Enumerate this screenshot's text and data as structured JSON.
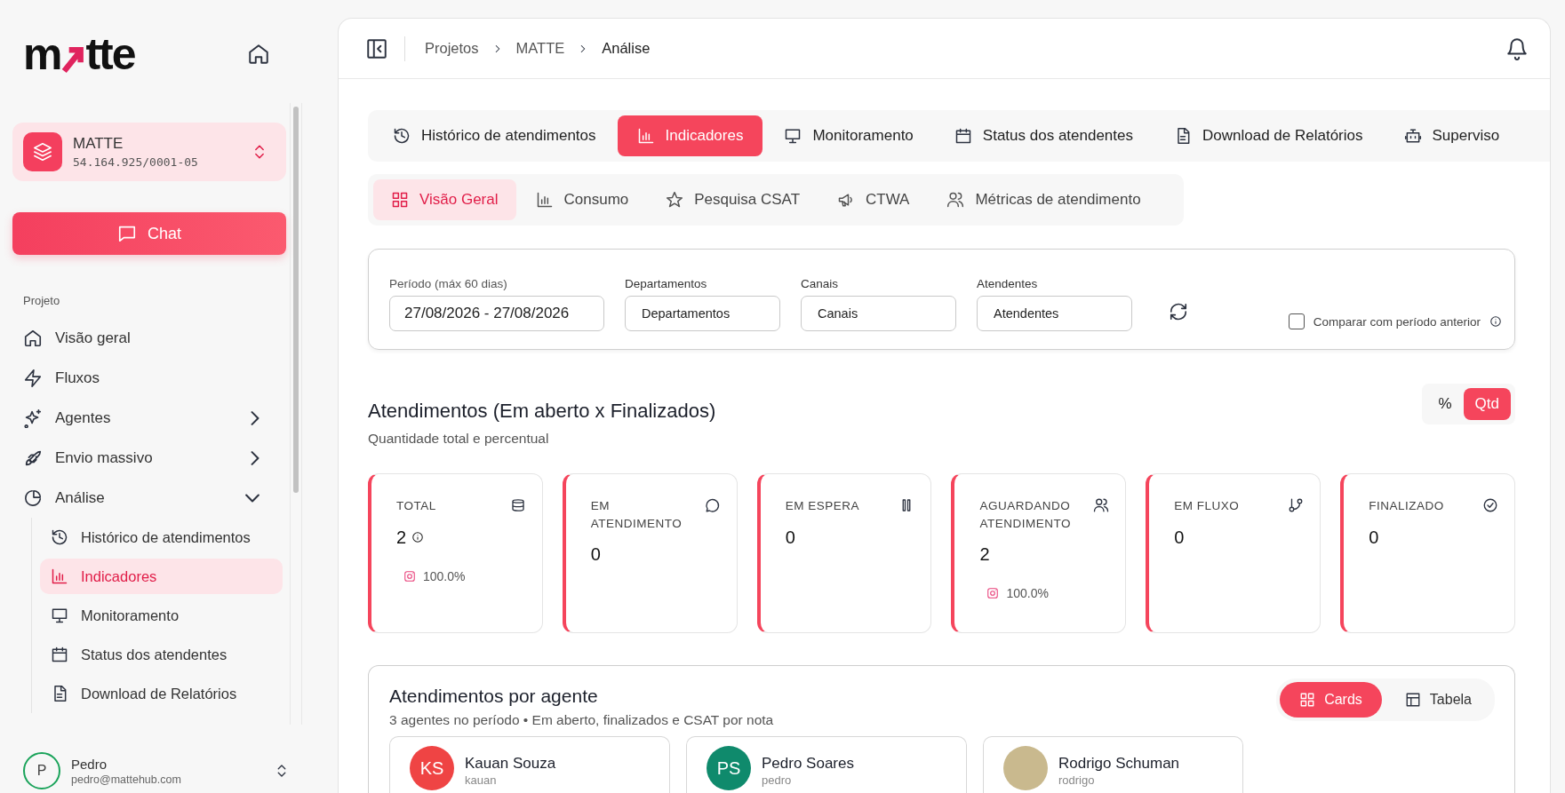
{
  "sidebar": {
    "logo": {
      "left": "m",
      "right": "tte"
    },
    "workspace": {
      "name": "MATTE",
      "id": "54.164.925/0001-05"
    },
    "chat_button": "Chat",
    "section_label": "Projeto",
    "nav": [
      {
        "label": "Visão geral"
      },
      {
        "label": "Fluxos"
      },
      {
        "label": "Agentes",
        "expanded": false
      },
      {
        "label": "Envio massivo",
        "expanded": false
      },
      {
        "label": "Análise",
        "expanded": true,
        "children": [
          {
            "label": "Histórico de atendimentos",
            "selected": false
          },
          {
            "label": "Indicadores",
            "selected": true
          },
          {
            "label": "Monitoramento",
            "selected": false
          },
          {
            "label": "Status dos atendentes",
            "selected": false
          },
          {
            "label": "Download de Relatórios",
            "selected": false
          }
        ]
      }
    ],
    "user": {
      "initial": "P",
      "name": "Pedro",
      "email": "pedro@mattehub.com"
    }
  },
  "breadcrumbs": [
    "Projetos",
    "MATTE",
    "Análise"
  ],
  "tabs": [
    {
      "label": "Histórico de atendimentos",
      "selected": false
    },
    {
      "label": "Indicadores",
      "selected": true
    },
    {
      "label": "Monitoramento",
      "selected": false
    },
    {
      "label": "Status dos atendentes",
      "selected": false
    },
    {
      "label": "Download de Relatórios",
      "selected": false
    },
    {
      "label": "Superviso",
      "selected": false
    }
  ],
  "subtabs": [
    {
      "label": "Visão Geral",
      "selected": true
    },
    {
      "label": "Consumo",
      "selected": false
    },
    {
      "label": "Pesquisa CSAT",
      "selected": false
    },
    {
      "label": "CTWA",
      "selected": false
    },
    {
      "label": "Métricas de atendimento",
      "selected": false
    }
  ],
  "filters": [
    {
      "label": "Período (máx 60 dias)",
      "value": "27/08/2026 - 27/08/2026"
    },
    {
      "label": "Departamentos",
      "value": "Departamentos"
    },
    {
      "label": "Canais",
      "value": "Canais"
    },
    {
      "label": "Atendentes",
      "value": "Atendentes"
    }
  ],
  "compare": {
    "label": "Comparar com período anterior",
    "checked": false
  },
  "summary": {
    "title": "Atendimentos (Em aberto x Finalizados)",
    "subtitle": "Quantidade total e percentual",
    "toggle": [
      {
        "label": "%",
        "selected": false
      },
      {
        "label": "Qtd",
        "selected": true
      }
    ],
    "cards": [
      {
        "label": "TOTAL",
        "value": "2",
        "share": "100.0%"
      },
      {
        "label": "EM ATENDIMENTO",
        "value": "0"
      },
      {
        "label": "EM ESPERA",
        "value": "0"
      },
      {
        "label": "AGUARDANDO ATENDIMENTO",
        "value": "2",
        "share": "100.0%"
      },
      {
        "label": "EM FLUXO",
        "value": "0"
      },
      {
        "label": "FINALIZADO",
        "value": "0"
      }
    ]
  },
  "agents": {
    "title": "Atendimentos por agente",
    "subtitle": "3 agentes no período • Em aberto, finalizados e CSAT por nota",
    "view_toggle": [
      {
        "label": "Cards",
        "selected": true
      },
      {
        "label": "Tabela",
        "selected": false
      }
    ],
    "items": [
      {
        "kind": "initials",
        "initials": "KS",
        "color": "#ef4444",
        "name": "Kauan Souza",
        "username": "kauan"
      },
      {
        "kind": "initials",
        "initials": "PS",
        "color": "#0f8a6c",
        "name": "Pedro Soares",
        "username": "pedro"
      },
      {
        "kind": "photo",
        "name": "Rodrigo Schuman",
        "username": "rodrigo"
      }
    ]
  }
}
